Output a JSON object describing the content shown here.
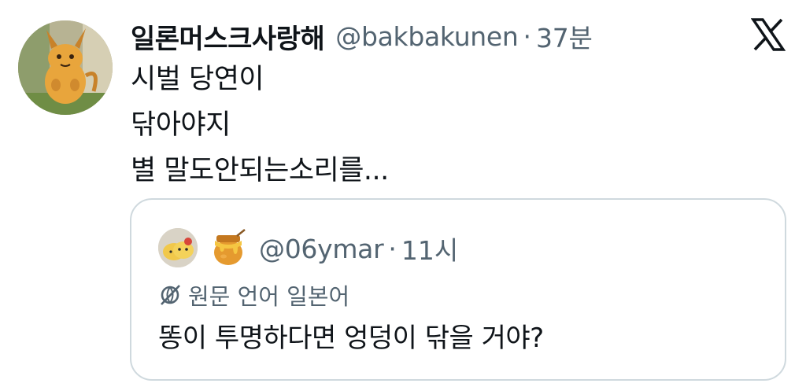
{
  "tweet": {
    "display_name": "일론머스크사랑해",
    "handle": "@bakbakunen",
    "separator": "·",
    "time": "37분",
    "lines": [
      "시벌 당연이",
      "닦아야지",
      "별 말도안되는소리를..."
    ]
  },
  "quote": {
    "handle": "@06ymar",
    "separator": "·",
    "time": "11시",
    "translation_note": "원문 언어 일본어",
    "text": "똥이 투명하다면 엉덩이 닦을 거야?"
  },
  "icons": {
    "platform_logo": "x-logo-icon",
    "translate": "no-globe-icon",
    "quote_emoji": "honey-pot-icon"
  },
  "colors": {
    "primary_text": "#0f1419",
    "secondary_text": "#536471",
    "card_border": "#cfd9de"
  }
}
